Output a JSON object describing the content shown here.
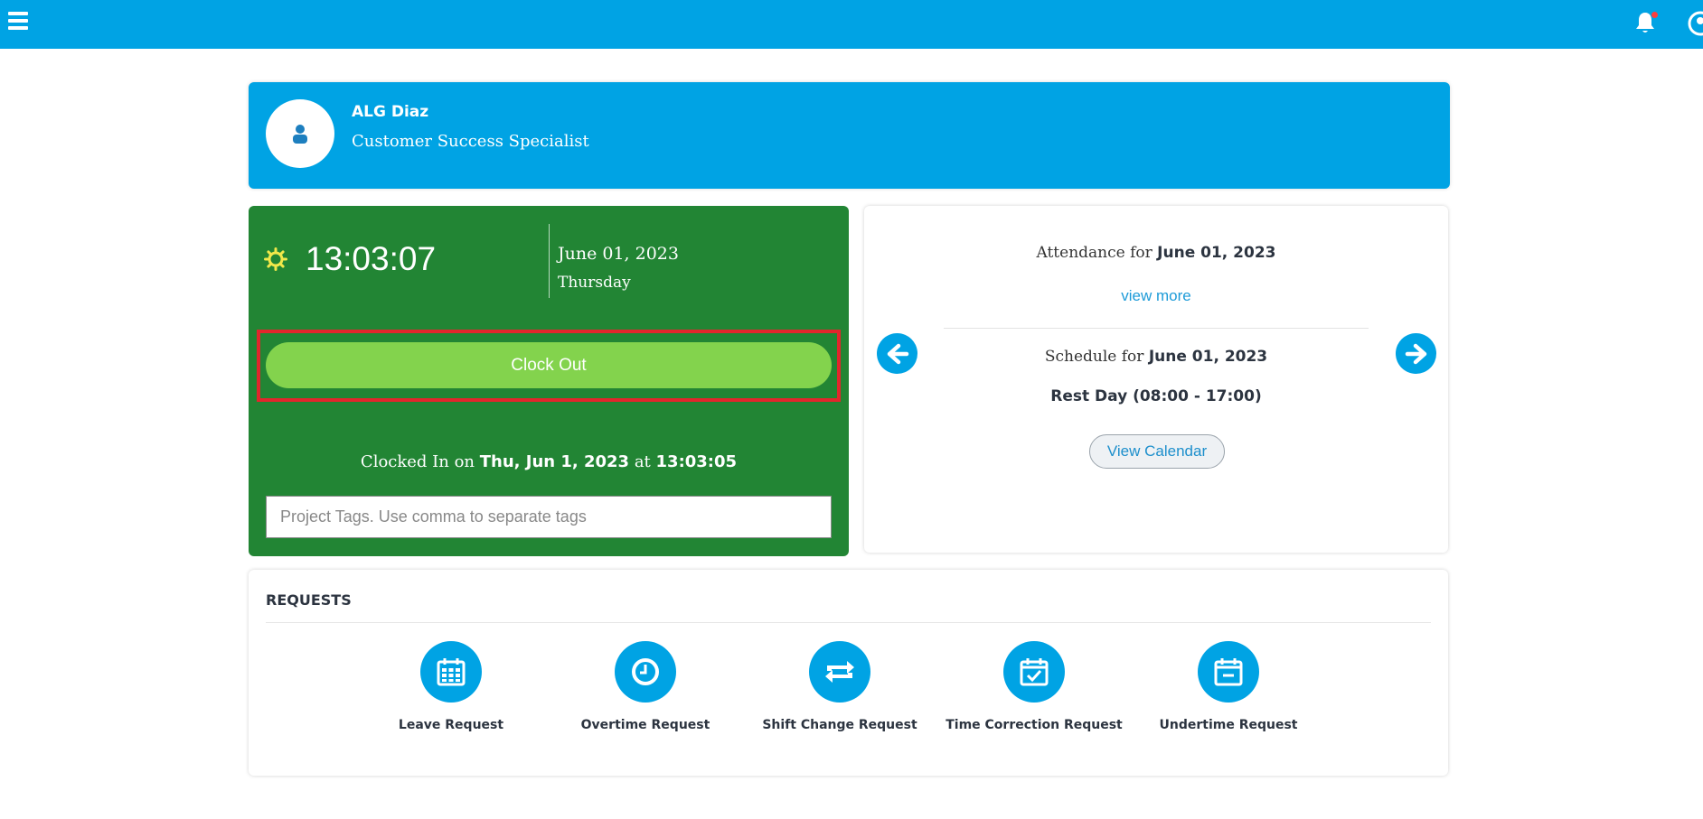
{
  "topbar": {
    "menu_icon": "hamburger-icon",
    "bell_icon": "bell-icon",
    "user_icon": "user-circle-icon",
    "accent": "#00a3e4"
  },
  "profile": {
    "name": "ALG Diaz",
    "title": "Customer Success Specialist",
    "avatar_icon": "user-icon"
  },
  "clock": {
    "icon": "sun-icon",
    "time": "13:03:07",
    "date": "June 01, 2023",
    "day": "Thursday",
    "clock_out_label": "Clock Out",
    "clocked_prefix": "Clocked In on ",
    "clocked_date": "Thu, Jun 1, 2023",
    "clocked_at": " at ",
    "clocked_time": "13:03:05",
    "tags_placeholder": "Project Tags. Use comma to separate tags",
    "card_color": "#228534",
    "button_color": "#83d34d"
  },
  "attendance": {
    "attendance_prefix": "Attendance for ",
    "attendance_date": "June 01, 2023",
    "view_more": "view more",
    "schedule_prefix": "Schedule for ",
    "schedule_date": "June 01, 2023",
    "rest_day": "Rest Day (08:00 - 17:00)",
    "view_calendar": "View Calendar",
    "prev_icon": "arrow-left-icon",
    "next_icon": "arrow-right-icon"
  },
  "requests": {
    "title": "REQUESTS",
    "items": [
      {
        "label": "Leave Request",
        "icon": "calendar-grid-icon"
      },
      {
        "label": "Overtime Request",
        "icon": "clock-icon"
      },
      {
        "label": "Shift Change Request",
        "icon": "swap-arrows-icon"
      },
      {
        "label": "Time Correction Request",
        "icon": "calendar-check-icon"
      },
      {
        "label": "Undertime Request",
        "icon": "calendar-minus-icon"
      }
    ]
  }
}
